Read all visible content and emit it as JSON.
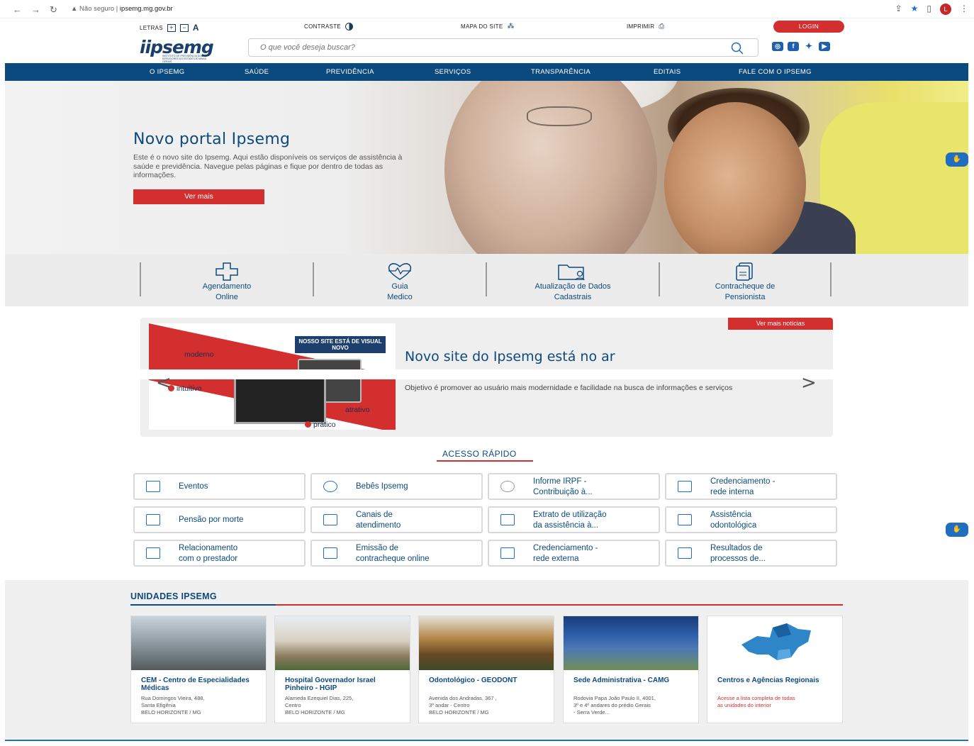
{
  "browser": {
    "insecure": "Não seguro",
    "url": "ipsemg.mg.gov.br",
    "profile_initial": "L"
  },
  "util": {
    "letras": "LETRAS",
    "contraste": "CONTRASTE",
    "mapa": "MAPA DO SITE",
    "imprimir": "IMPRIMIR",
    "login": "LOGIN"
  },
  "header": {
    "logo": "iipsemg",
    "logo_sub": "INSTITUTO DE PREVIDÊNCIA DOS SERVIDORES DO ESTADO DE MINAS GERAIS",
    "search_placeholder": "O que você deseja buscar?"
  },
  "nav": [
    "O IPSEMG",
    "SAÚDE",
    "PREVIDÊNCIA",
    "SERVIÇOS",
    "TRANSPARÊNCIA",
    "EDITAIS",
    "FALE COM O IPSEMG"
  ],
  "hero": {
    "title": "Novo portal Ipsemg",
    "text": "Este é o novo site do Ipsemg. Aqui estão disponíveis os serviços de assistência à saúde e previdência. Navegue pelas páginas e fique por dentro de todas as informações.",
    "button": "Ver mais"
  },
  "quick": [
    {
      "l1": "Agendamento",
      "l2": "Online"
    },
    {
      "l1": "Guia",
      "l2": "Medico"
    },
    {
      "l1": "Atualização de Dados",
      "l2": "Cadastrais"
    },
    {
      "l1": "Contracheque de",
      "l2": "Pensionista"
    }
  ],
  "news": {
    "more": "Ver mais notícias",
    "title": "Novo site do Ipsemg está no ar",
    "desc": "Objetivo é promover ao usuário mais modernidade e facilidade na busca de informações e serviços",
    "img_tag": "NOSSO SITE ESTÁ DE VISUAL NOVO",
    "img_words": [
      "moderno",
      "intuitivo",
      "intuitivo",
      "atrativo",
      "prático"
    ]
  },
  "acesso": {
    "title": "ACESSO RÁPIDO",
    "items": [
      {
        "l1": "Eventos",
        "l2": ""
      },
      {
        "l1": "Bebês Ipsemg",
        "l2": ""
      },
      {
        "l1": "Informe IRPF -",
        "l2": "Contribuição à..."
      },
      {
        "l1": "Credenciamento -",
        "l2": "rede interna"
      },
      {
        "l1": "Pensão por morte",
        "l2": ""
      },
      {
        "l1": "Canais de",
        "l2": "atendimento"
      },
      {
        "l1": "Extrato de utilização",
        "l2": "da assistência à..."
      },
      {
        "l1": "Assistência",
        "l2": "odontológica"
      },
      {
        "l1": "Relacionamento",
        "l2": "com o prestador"
      },
      {
        "l1": "Emissão de",
        "l2": "contracheque online"
      },
      {
        "l1": "Credenciamento -",
        "l2": "rede externa"
      },
      {
        "l1": "Resultados de",
        "l2": "processos de..."
      }
    ]
  },
  "unidades": {
    "title": "UNIDADES IPSEMG",
    "cards": [
      {
        "name": "CEM - Centro de Especialidades Médicas",
        "a1": "Rua Domingos Vieira, 488,",
        "a2": "Santa Efigênia",
        "a3": "BELO HORIZONTE / MG"
      },
      {
        "name": "Hospital Governador Israel Pinheiro - HGIP",
        "a1": "Alameda Ezequiel Dias, 225,",
        "a2": "Centro",
        "a3": "BELO HORIZONTE / MG"
      },
      {
        "name": "Odontológico - GEODONT",
        "a1": "Avenida dos Andradas, 367 ,",
        "a2": "3º andar - Centro",
        "a3": "BELO HORIZONTE / MG"
      },
      {
        "name": "Sede Administrativa - CAMG",
        "a1": "Rodovia Papa João Paulo II, 4001,",
        "a2": "3º e 4º andares do prédio Gerais",
        "a3": "- Serra Verde..."
      },
      {
        "name": "Centros e Agências Regionais",
        "a1": "Acesse a lista completa de todas",
        "a2": "as unidades do interior",
        "a3": ""
      }
    ]
  },
  "colors": {
    "primary": "#0a4a7f",
    "accent": "#d32f2f"
  }
}
